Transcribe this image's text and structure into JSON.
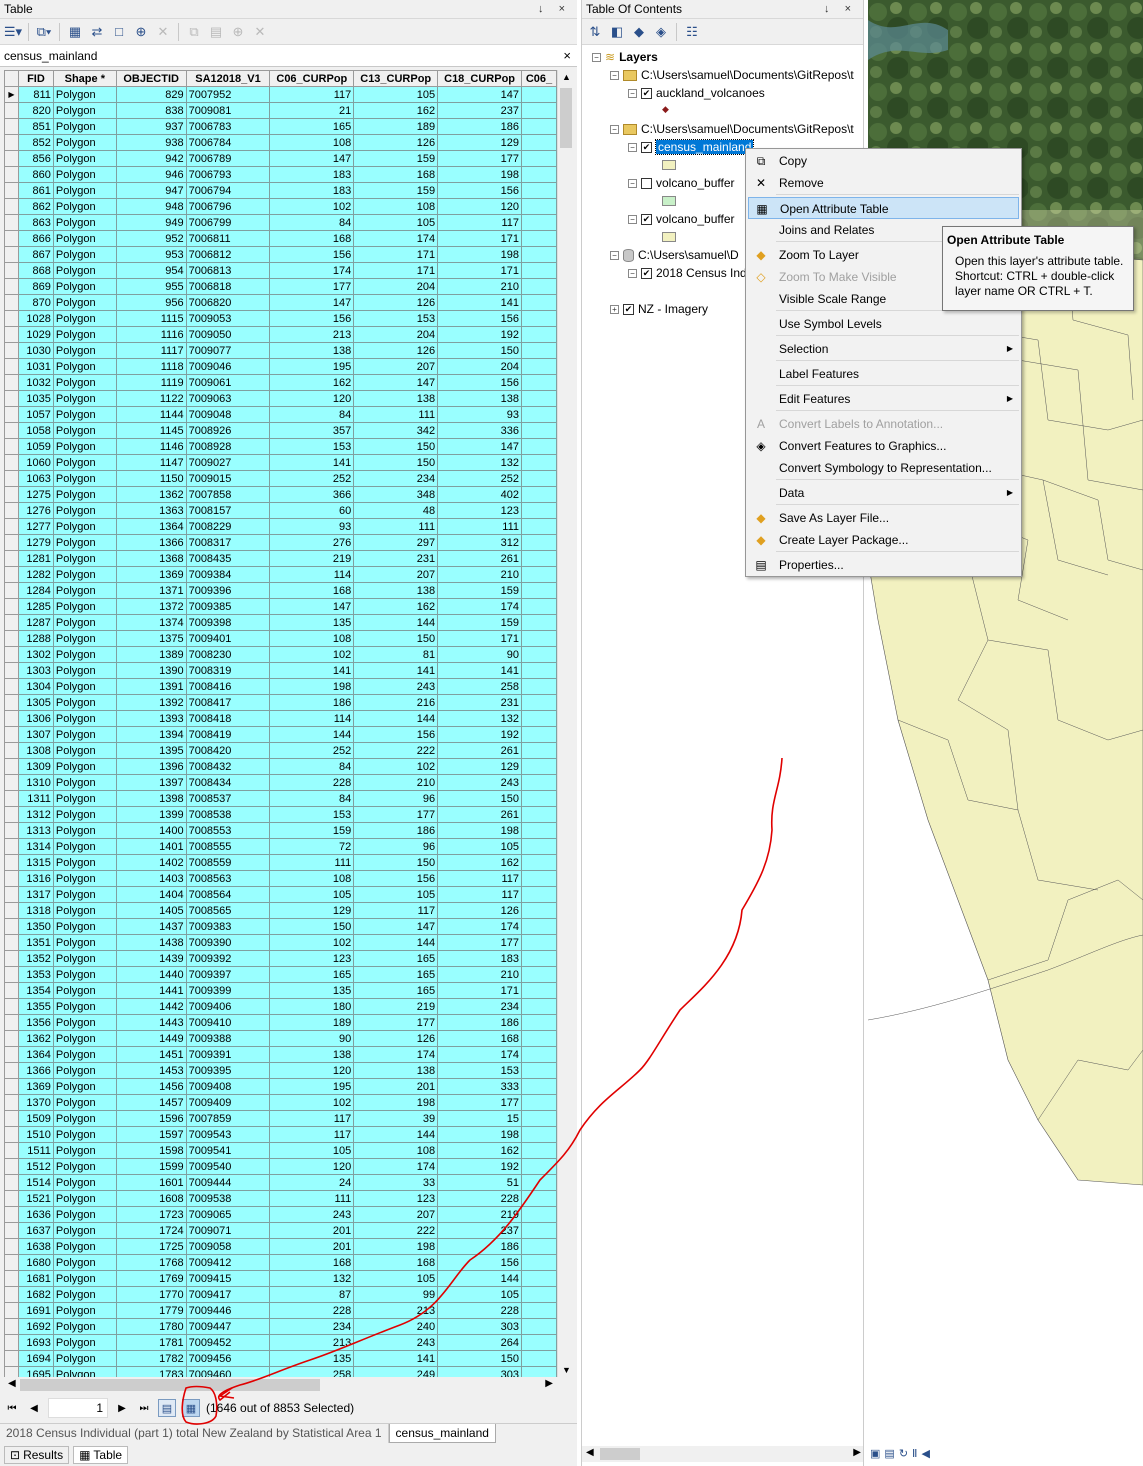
{
  "table_window": {
    "title": "Table",
    "pin": "↓ ×",
    "layer_tab": "census_mainland",
    "columns": [
      "FID",
      "Shape *",
      "OBJECTID",
      "SA12018_V1",
      "C06_CURPop",
      "C13_CURPop",
      "C18_CURPop",
      "C06_"
    ],
    "rows": [
      [
        "811",
        "Polygon",
        "829",
        "7007952",
        "117",
        "105",
        "147"
      ],
      [
        "820",
        "Polygon",
        "838",
        "7009081",
        "21",
        "162",
        "237"
      ],
      [
        "851",
        "Polygon",
        "937",
        "7006783",
        "165",
        "189",
        "186"
      ],
      [
        "852",
        "Polygon",
        "938",
        "7006784",
        "108",
        "126",
        "129"
      ],
      [
        "856",
        "Polygon",
        "942",
        "7006789",
        "147",
        "159",
        "177"
      ],
      [
        "860",
        "Polygon",
        "946",
        "7006793",
        "183",
        "168",
        "198"
      ],
      [
        "861",
        "Polygon",
        "947",
        "7006794",
        "183",
        "159",
        "156"
      ],
      [
        "862",
        "Polygon",
        "948",
        "7006796",
        "102",
        "108",
        "120"
      ],
      [
        "863",
        "Polygon",
        "949",
        "7006799",
        "84",
        "105",
        "117"
      ],
      [
        "866",
        "Polygon",
        "952",
        "7006811",
        "168",
        "174",
        "171"
      ],
      [
        "867",
        "Polygon",
        "953",
        "7006812",
        "156",
        "171",
        "198"
      ],
      [
        "868",
        "Polygon",
        "954",
        "7006813",
        "174",
        "171",
        "171"
      ],
      [
        "869",
        "Polygon",
        "955",
        "7006818",
        "177",
        "204",
        "210"
      ],
      [
        "870",
        "Polygon",
        "956",
        "7006820",
        "147",
        "126",
        "141"
      ],
      [
        "1028",
        "Polygon",
        "1115",
        "7009053",
        "156",
        "153",
        "156"
      ],
      [
        "1029",
        "Polygon",
        "1116",
        "7009050",
        "213",
        "204",
        "192"
      ],
      [
        "1030",
        "Polygon",
        "1117",
        "7009077",
        "138",
        "126",
        "150"
      ],
      [
        "1031",
        "Polygon",
        "1118",
        "7009046",
        "195",
        "207",
        "204"
      ],
      [
        "1032",
        "Polygon",
        "1119",
        "7009061",
        "162",
        "147",
        "156"
      ],
      [
        "1035",
        "Polygon",
        "1122",
        "7009063",
        "120",
        "138",
        "138"
      ],
      [
        "1057",
        "Polygon",
        "1144",
        "7009048",
        "84",
        "111",
        "93"
      ],
      [
        "1058",
        "Polygon",
        "1145",
        "7008926",
        "357",
        "342",
        "336"
      ],
      [
        "1059",
        "Polygon",
        "1146",
        "7008928",
        "153",
        "150",
        "147"
      ],
      [
        "1060",
        "Polygon",
        "1147",
        "7009027",
        "141",
        "150",
        "132"
      ],
      [
        "1063",
        "Polygon",
        "1150",
        "7009015",
        "252",
        "234",
        "252"
      ],
      [
        "1275",
        "Polygon",
        "1362",
        "7007858",
        "366",
        "348",
        "402"
      ],
      [
        "1276",
        "Polygon",
        "1363",
        "7008157",
        "60",
        "48",
        "123"
      ],
      [
        "1277",
        "Polygon",
        "1364",
        "7008229",
        "93",
        "111",
        "111"
      ],
      [
        "1279",
        "Polygon",
        "1366",
        "7008317",
        "276",
        "297",
        "312"
      ],
      [
        "1281",
        "Polygon",
        "1368",
        "7008435",
        "219",
        "231",
        "261"
      ],
      [
        "1282",
        "Polygon",
        "1369",
        "7009384",
        "114",
        "207",
        "210"
      ],
      [
        "1284",
        "Polygon",
        "1371",
        "7009396",
        "168",
        "138",
        "159"
      ],
      [
        "1285",
        "Polygon",
        "1372",
        "7009385",
        "147",
        "162",
        "174"
      ],
      [
        "1287",
        "Polygon",
        "1374",
        "7009398",
        "135",
        "144",
        "159"
      ],
      [
        "1288",
        "Polygon",
        "1375",
        "7009401",
        "108",
        "150",
        "171"
      ],
      [
        "1302",
        "Polygon",
        "1389",
        "7008230",
        "102",
        "81",
        "90"
      ],
      [
        "1303",
        "Polygon",
        "1390",
        "7008319",
        "141",
        "141",
        "141"
      ],
      [
        "1304",
        "Polygon",
        "1391",
        "7008416",
        "198",
        "243",
        "258"
      ],
      [
        "1305",
        "Polygon",
        "1392",
        "7008417",
        "186",
        "216",
        "231"
      ],
      [
        "1306",
        "Polygon",
        "1393",
        "7008418",
        "114",
        "144",
        "132"
      ],
      [
        "1307",
        "Polygon",
        "1394",
        "7008419",
        "144",
        "156",
        "192"
      ],
      [
        "1308",
        "Polygon",
        "1395",
        "7008420",
        "252",
        "222",
        "261"
      ],
      [
        "1309",
        "Polygon",
        "1396",
        "7008432",
        "84",
        "102",
        "129"
      ],
      [
        "1310",
        "Polygon",
        "1397",
        "7008434",
        "228",
        "210",
        "243"
      ],
      [
        "1311",
        "Polygon",
        "1398",
        "7008537",
        "84",
        "96",
        "150"
      ],
      [
        "1312",
        "Polygon",
        "1399",
        "7008538",
        "153",
        "177",
        "261"
      ],
      [
        "1313",
        "Polygon",
        "1400",
        "7008553",
        "159",
        "186",
        "198"
      ],
      [
        "1314",
        "Polygon",
        "1401",
        "7008555",
        "72",
        "96",
        "105"
      ],
      [
        "1315",
        "Polygon",
        "1402",
        "7008559",
        "111",
        "150",
        "162"
      ],
      [
        "1316",
        "Polygon",
        "1403",
        "7008563",
        "108",
        "156",
        "117"
      ],
      [
        "1317",
        "Polygon",
        "1404",
        "7008564",
        "105",
        "105",
        "117"
      ],
      [
        "1318",
        "Polygon",
        "1405",
        "7008565",
        "129",
        "117",
        "126"
      ],
      [
        "1350",
        "Polygon",
        "1437",
        "7009383",
        "150",
        "147",
        "174"
      ],
      [
        "1351",
        "Polygon",
        "1438",
        "7009390",
        "102",
        "144",
        "177"
      ],
      [
        "1352",
        "Polygon",
        "1439",
        "7009392",
        "123",
        "165",
        "183"
      ],
      [
        "1353",
        "Polygon",
        "1440",
        "7009397",
        "165",
        "165",
        "210"
      ],
      [
        "1354",
        "Polygon",
        "1441",
        "7009399",
        "135",
        "165",
        "171"
      ],
      [
        "1355",
        "Polygon",
        "1442",
        "7009406",
        "180",
        "219",
        "234"
      ],
      [
        "1356",
        "Polygon",
        "1443",
        "7009410",
        "189",
        "177",
        "186"
      ],
      [
        "1362",
        "Polygon",
        "1449",
        "7009388",
        "90",
        "126",
        "168"
      ],
      [
        "1364",
        "Polygon",
        "1451",
        "7009391",
        "138",
        "174",
        "174"
      ],
      [
        "1366",
        "Polygon",
        "1453",
        "7009395",
        "120",
        "138",
        "153"
      ],
      [
        "1369",
        "Polygon",
        "1456",
        "7009408",
        "195",
        "201",
        "333"
      ],
      [
        "1370",
        "Polygon",
        "1457",
        "7009409",
        "102",
        "198",
        "177"
      ],
      [
        "1509",
        "Polygon",
        "1596",
        "7007859",
        "117",
        "39",
        "15"
      ],
      [
        "1510",
        "Polygon",
        "1597",
        "7009543",
        "117",
        "144",
        "198"
      ],
      [
        "1511",
        "Polygon",
        "1598",
        "7009541",
        "105",
        "108",
        "162"
      ],
      [
        "1512",
        "Polygon",
        "1599",
        "7009540",
        "120",
        "174",
        "192"
      ],
      [
        "1514",
        "Polygon",
        "1601",
        "7009444",
        "24",
        "33",
        "51"
      ],
      [
        "1521",
        "Polygon",
        "1608",
        "7009538",
        "111",
        "123",
        "228"
      ],
      [
        "1636",
        "Polygon",
        "1723",
        "7009065",
        "243",
        "207",
        "219"
      ],
      [
        "1637",
        "Polygon",
        "1724",
        "7009071",
        "201",
        "222",
        "237"
      ],
      [
        "1638",
        "Polygon",
        "1725",
        "7009058",
        "201",
        "198",
        "186"
      ],
      [
        "1680",
        "Polygon",
        "1768",
        "7009412",
        "168",
        "168",
        "156"
      ],
      [
        "1681",
        "Polygon",
        "1769",
        "7009415",
        "132",
        "105",
        "144"
      ],
      [
        "1682",
        "Polygon",
        "1770",
        "7009417",
        "87",
        "99",
        "105"
      ],
      [
        "1691",
        "Polygon",
        "1779",
        "7009446",
        "228",
        "213",
        "228"
      ],
      [
        "1692",
        "Polygon",
        "1780",
        "7009447",
        "234",
        "240",
        "303"
      ],
      [
        "1693",
        "Polygon",
        "1781",
        "7009452",
        "213",
        "243",
        "264"
      ],
      [
        "1694",
        "Polygon",
        "1782",
        "7009456",
        "135",
        "141",
        "150"
      ],
      [
        "1695",
        "Polygon",
        "1783",
        "7009460",
        "258",
        "249",
        "303"
      ]
    ],
    "record_number": "1",
    "selection_text": "(1646 out of 8853 Selected)",
    "doc_tabs": [
      "2018 Census Individual (part 1) total New Zealand by Statistical Area 1",
      "census_mainland"
    ],
    "bottom_tabs": [
      "Results",
      "Table"
    ]
  },
  "toc": {
    "title": "Table Of Contents",
    "pin": "↓ ×",
    "root": "Layers",
    "folder1": "C:\\Users\\samuel\\Documents\\GitRepos\\t",
    "layer_volcanoes": "auckland_volcanoes",
    "folder2": "C:\\Users\\samuel\\Documents\\GitRepos\\t",
    "layer_census": "census_mainland",
    "layer_buffer1": "volcano_buffer",
    "layer_buffer2": "volcano_buffer",
    "folder3": "C:\\Users\\samuel\\D",
    "layer_2018": "2018 Census Ind",
    "layer_imagery": "NZ - Imagery"
  },
  "context_menu": {
    "items": [
      {
        "label": "Copy",
        "icon": "copy-icon"
      },
      {
        "label": "Remove",
        "icon": "remove-icon"
      },
      {
        "label": "Open Attribute Table",
        "icon": "table-icon"
      },
      {
        "label": "Joins and Relates",
        "icon": ""
      },
      {
        "label": "Zoom To Layer",
        "icon": "zoom-layer-icon"
      },
      {
        "label": "Zoom To Make Visible",
        "icon": "zoom-visible-icon"
      },
      {
        "label": "Visible Scale Range",
        "icon": ""
      },
      {
        "label": "Use Symbol Levels",
        "icon": ""
      },
      {
        "label": "Selection",
        "icon": ""
      },
      {
        "label": "Label Features",
        "icon": ""
      },
      {
        "label": "Edit Features",
        "icon": ""
      },
      {
        "label": "Convert Labels to Annotation...",
        "icon": "annotation-icon"
      },
      {
        "label": "Convert Features to Graphics...",
        "icon": "graphics-icon"
      },
      {
        "label": "Convert Symbology to Representation...",
        "icon": ""
      },
      {
        "label": "Data",
        "icon": ""
      },
      {
        "label": "Save As Layer File...",
        "icon": "layer-file-icon"
      },
      {
        "label": "Create Layer Package...",
        "icon": "layer-package-icon"
      },
      {
        "label": "Properties...",
        "icon": "properties-icon"
      }
    ]
  },
  "tooltip": {
    "title": "Open Attribute Table",
    "body": "Open this layer's attribute table. Shortcut: CTRL + double-click layer name OR CTRL + T."
  },
  "colors": {
    "selected_row": "#99ffff",
    "polygon_fill": "#f2f1c0",
    "annotation": "#e00000",
    "highlight": "#cce4f7"
  }
}
